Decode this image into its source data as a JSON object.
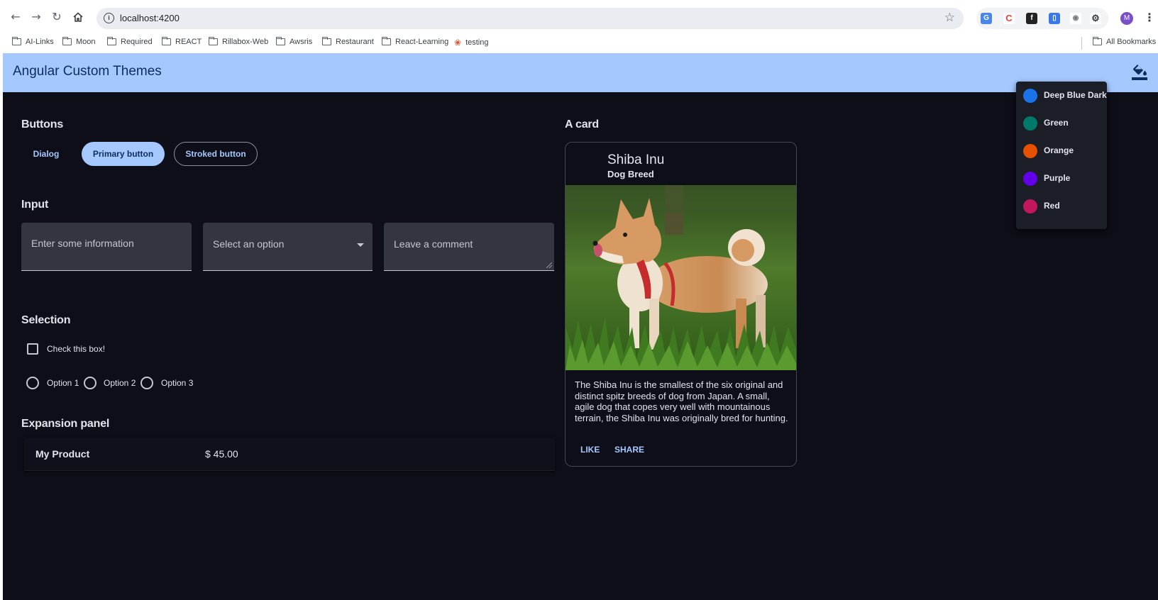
{
  "browser": {
    "url": "localhost:4200",
    "avatar_initial": "M",
    "bookmarks": [
      "AI-Links",
      "Moon",
      "Required",
      "REACT",
      "Rillabox-Web",
      "Awsris",
      "Restaurant",
      "React-Learning",
      "testing"
    ],
    "all_bookmarks": "All Bookmarks"
  },
  "toolbar": {
    "title": "Angular Custom Themes"
  },
  "buttons": {
    "title": "Buttons",
    "dialog": "Dialog",
    "primary": "Primary button",
    "stroked": "Stroked button"
  },
  "input": {
    "title": "Input",
    "text_placeholder": "Enter some information",
    "select_placeholder": "Select an option",
    "comment_placeholder": "Leave a comment"
  },
  "selection": {
    "title": "Selection",
    "checkbox_label": "Check this box!",
    "radios": [
      "Option 1",
      "Option 2",
      "Option 3"
    ]
  },
  "expansion": {
    "title": "Expansion panel",
    "product": "My Product",
    "price": "$ 45.00"
  },
  "card": {
    "section_title": "A card",
    "title": "Shiba Inu",
    "subtitle": "Dog Breed",
    "body": "The Shiba Inu is the smallest of the six original and distinct spitz breeds of dog from Japan. A small, agile dog that copes very well with mountainous terrain, the Shiba Inu was originally bred for hunting.",
    "like": "LIKE",
    "share": "SHARE"
  },
  "theme_menu": {
    "items": [
      {
        "label": "Deep Blue Dark",
        "color": "#1a73e8"
      },
      {
        "label": "Green",
        "color": "#00796b"
      },
      {
        "label": "Orange",
        "color": "#e65100"
      },
      {
        "label": "Purple",
        "color": "#6200ea"
      },
      {
        "label": "Red",
        "color": "#c2185b"
      }
    ]
  },
  "colors": {
    "primary": "#a5c8ff",
    "background": "#0d0e17",
    "surface": "#33353f"
  }
}
